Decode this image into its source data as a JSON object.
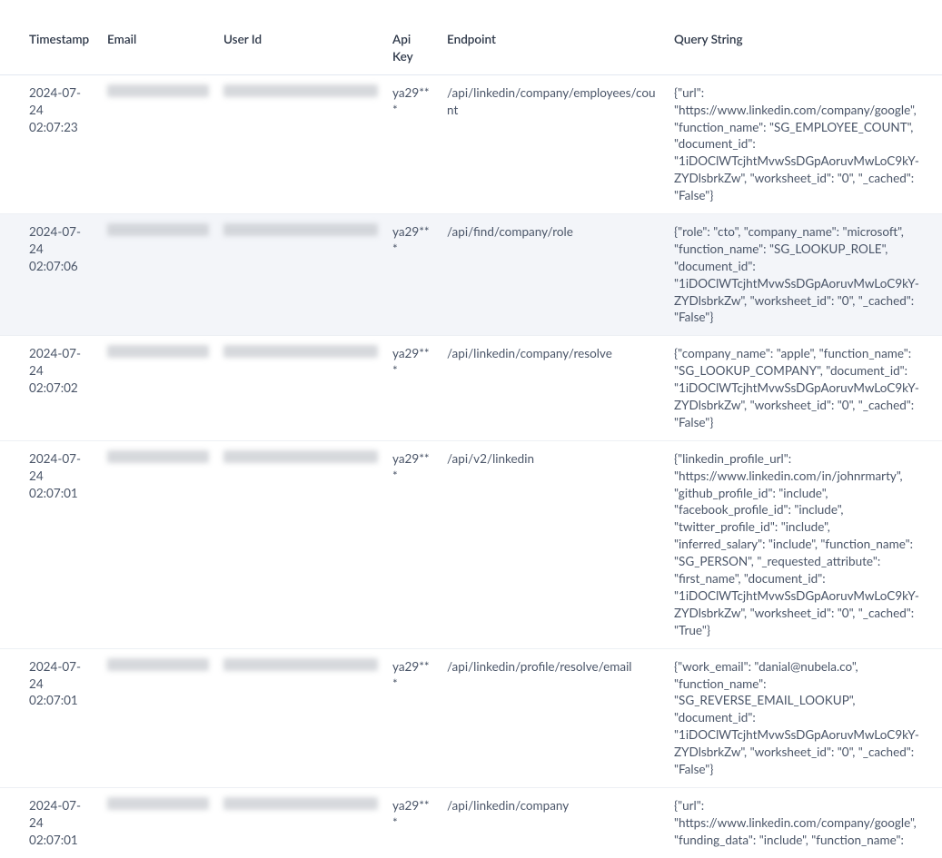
{
  "headers": {
    "timestamp": "Timestamp",
    "email": "Email",
    "user_id": "User Id",
    "api_key": "Api Key",
    "endpoint": "Endpoint",
    "query_string": "Query String"
  },
  "rows": [
    {
      "timestamp": "2024-07-24 02:07:23",
      "email_redacted": true,
      "user_id_redacted": true,
      "api_key": "ya29***",
      "endpoint": "/api/linkedin/company/employees/count",
      "query_string": "{\"url\": \"https://www.linkedin.com/company/google\", \"function_name\": \"SG_EMPLOYEE_COUNT\", \"document_id\": \"1iDOClWTcjhtMvwSsDGpAoruvMwLoC9kY-ZYDlsbrkZw\", \"worksheet_id\": \"0\", \"_cached\": \"False\"}",
      "highlight": false
    },
    {
      "timestamp": "2024-07-24 02:07:06",
      "email_redacted": true,
      "user_id_redacted": true,
      "api_key": "ya29***",
      "endpoint": "/api/find/company/role",
      "query_string": "{\"role\": \"cto\", \"company_name\": \"microsoft\", \"function_name\": \"SG_LOOKUP_ROLE\", \"document_id\": \"1iDOClWTcjhtMvwSsDGpAoruvMwLoC9kY-ZYDlsbrkZw\", \"worksheet_id\": \"0\", \"_cached\": \"False\"}",
      "highlight": true
    },
    {
      "timestamp": "2024-07-24 02:07:02",
      "email_redacted": true,
      "user_id_redacted": true,
      "api_key": "ya29***",
      "endpoint": "/api/linkedin/company/resolve",
      "query_string": "{\"company_name\": \"apple\", \"function_name\": \"SG_LOOKUP_COMPANY\", \"document_id\": \"1iDOClWTcjhtMvwSsDGpAoruvMwLoC9kY-ZYDlsbrkZw\", \"worksheet_id\": \"0\", \"_cached\": \"False\"}",
      "highlight": false
    },
    {
      "timestamp": "2024-07-24 02:07:01",
      "email_redacted": true,
      "user_id_redacted": true,
      "api_key": "ya29***",
      "endpoint": "/api/v2/linkedin",
      "query_string": "{\"linkedin_profile_url\": \"https://www.linkedin.com/in/johnrmarty\", \"github_profile_id\": \"include\", \"facebook_profile_id\": \"include\", \"twitter_profile_id\": \"include\", \"inferred_salary\": \"include\", \"function_name\": \"SG_PERSON\", \"_requested_attribute\": \"first_name\", \"document_id\": \"1iDOClWTcjhtMvwSsDGpAoruvMwLoC9kY-ZYDlsbrkZw\", \"worksheet_id\": \"0\", \"_cached\": \"True\"}",
      "highlight": false
    },
    {
      "timestamp": "2024-07-24 02:07:01",
      "email_redacted": true,
      "user_id_redacted": true,
      "api_key": "ya29***",
      "endpoint": "/api/linkedin/profile/resolve/email",
      "query_string": "{\"work_email\": \"danial@nubela.co\", \"function_name\": \"SG_REVERSE_EMAIL_LOOKUP\", \"document_id\": \"1iDOClWTcjhtMvwSsDGpAoruvMwLoC9kY-ZYDlsbrkZw\", \"worksheet_id\": \"0\", \"_cached\": \"False\"}",
      "highlight": false
    },
    {
      "timestamp": "2024-07-24 02:07:01",
      "email_redacted": true,
      "user_id_redacted": true,
      "api_key": "ya29***",
      "endpoint": "/api/linkedin/company",
      "query_string": "{\"url\": \"https://www.linkedin.com/company/google\", \"funding_data\": \"include\", \"function_name\":",
      "highlight": false
    }
  ]
}
